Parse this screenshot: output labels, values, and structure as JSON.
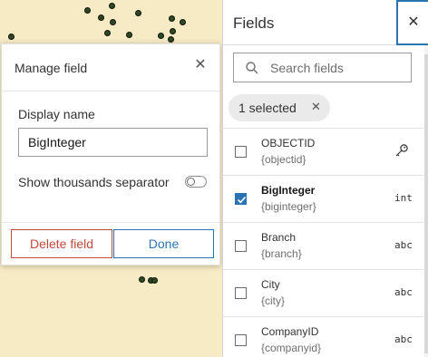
{
  "dialog": {
    "title": "Manage field",
    "display_name_label": "Display name",
    "display_name_value": "BigInteger",
    "thousands_separator_label": "Show thousands separator",
    "thousands_separator_on": false,
    "delete_label": "Delete field",
    "done_label": "Done"
  },
  "panel": {
    "title": "Fields",
    "search_placeholder": "Search fields",
    "selected_chip": "1 selected",
    "fields": [
      {
        "name": "OBJECTID",
        "alias": "{objectid}",
        "type": "key-icon",
        "checked": false
      },
      {
        "name": "BigInteger",
        "alias": "{biginteger}",
        "type": "int",
        "checked": true
      },
      {
        "name": "Branch",
        "alias": "{branch}",
        "type": "abc",
        "checked": false
      },
      {
        "name": "City",
        "alias": "{city}",
        "type": "abc",
        "checked": false
      },
      {
        "name": "CompanyID",
        "alias": "{companyid}",
        "type": "abc",
        "checked": false
      }
    ]
  },
  "colors": {
    "accent": "#2a73b1",
    "danger": "#c14a3a",
    "map_bg": "#f6ebc5",
    "point": "#2f4a1c"
  }
}
